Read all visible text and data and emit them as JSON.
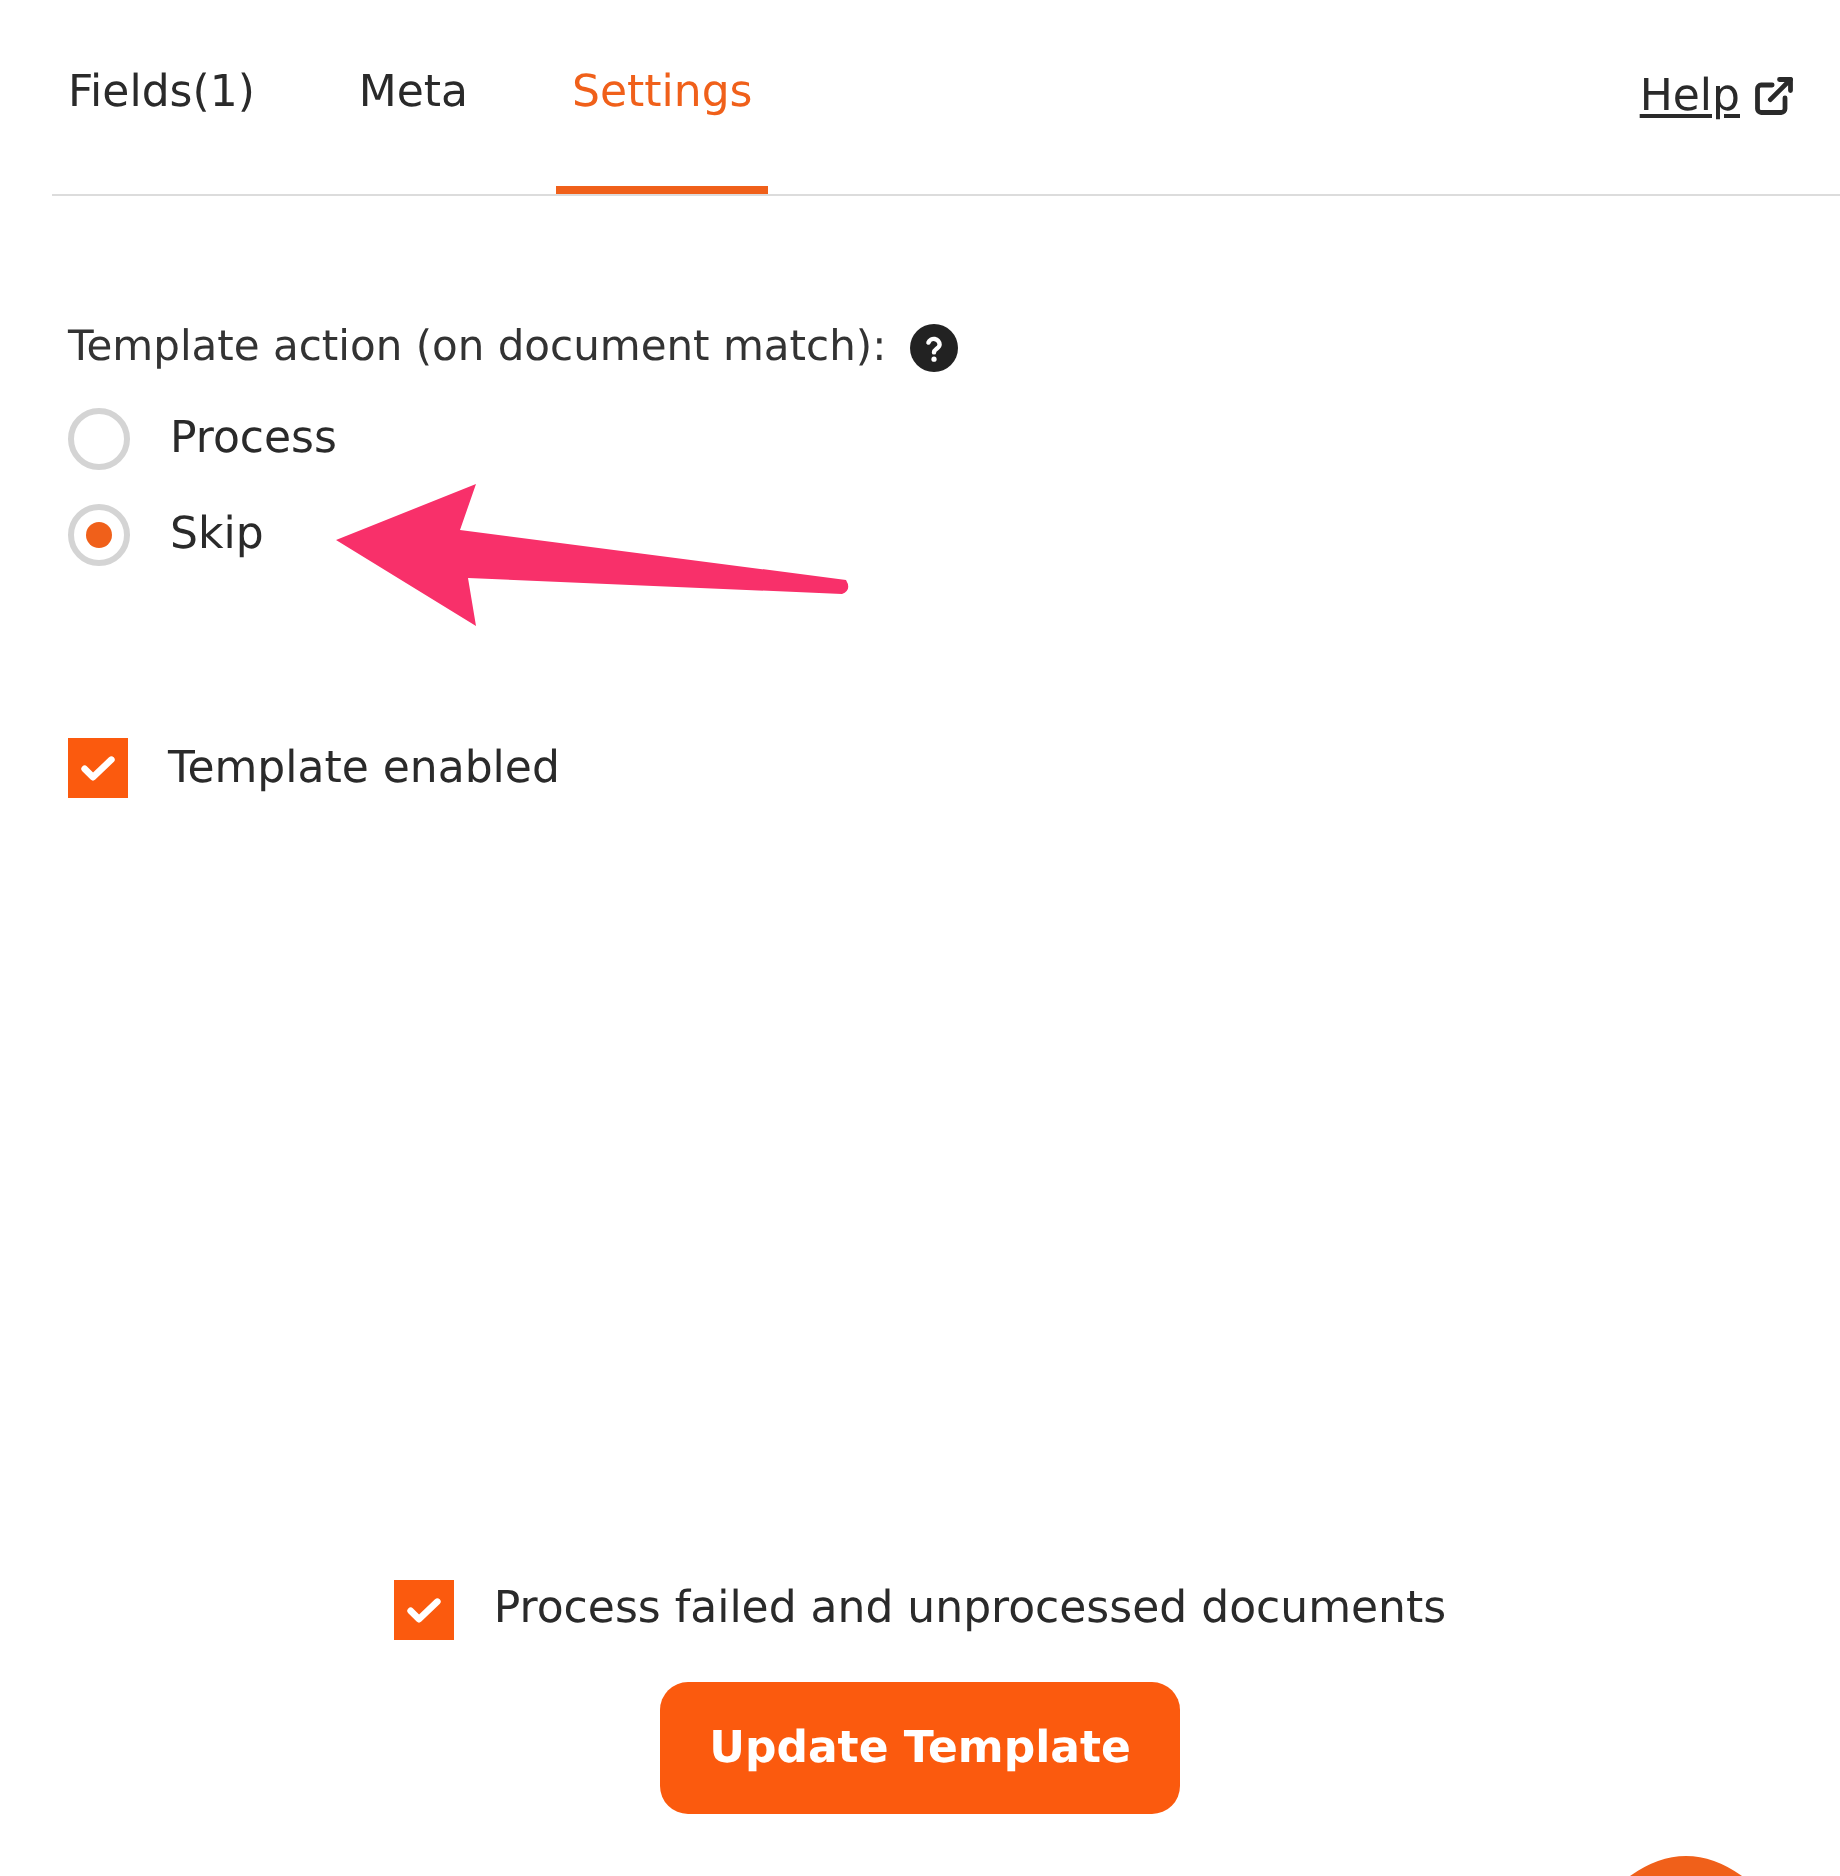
{
  "tabs": [
    {
      "label": "Fields(1)",
      "selected": false
    },
    {
      "label": "Meta",
      "selected": false
    },
    {
      "label": "Settings",
      "selected": true
    }
  ],
  "help_link": {
    "label": "Help"
  },
  "template_action": {
    "label": "Template action (on document match):",
    "options": [
      {
        "label": "Process",
        "selected": false
      },
      {
        "label": "Skip",
        "selected": true
      }
    ]
  },
  "template_enabled": {
    "label": "Template enabled",
    "checked": true
  },
  "process_failed": {
    "label": "Process failed and unprocessed documents",
    "checked": true
  },
  "submit_button": {
    "label": "Update Template"
  }
}
